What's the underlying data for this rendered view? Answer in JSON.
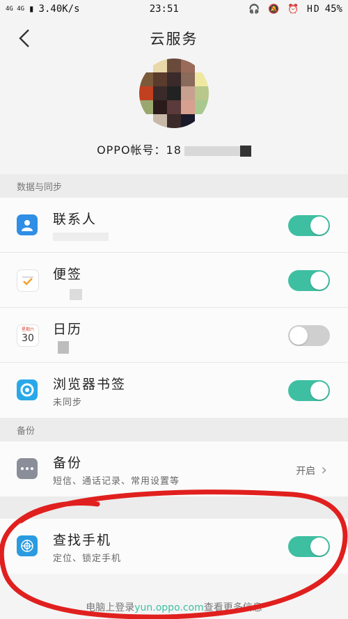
{
  "status_bar": {
    "network": "4G 4G",
    "speed": "3.40K/s",
    "time": "23:51",
    "icons": "🎧 🔕 ⏰ HD",
    "battery": "45%"
  },
  "header": {
    "title": "云服务"
  },
  "profile": {
    "account_label": "OPPO帐号：18"
  },
  "sections": {
    "sync_title": "数据与同步",
    "backup_title": "备份"
  },
  "sync_items": [
    {
      "label": "联系人",
      "sub": ""
    },
    {
      "label": "便签",
      "sub": ""
    },
    {
      "label": "日历",
      "sub": ""
    },
    {
      "label": "浏览器书签",
      "sub": "未同步"
    }
  ],
  "sync_toggles": [
    "on",
    "on",
    "off",
    "on"
  ],
  "calendar_icon": {
    "weekday": "星期六",
    "day": "30"
  },
  "backup_item": {
    "label": "备份",
    "sub": "短信、通话记录、常用设置等",
    "value": "开启"
  },
  "find_item": {
    "label": "查找手机",
    "sub": "定位、锁定手机",
    "toggle": "on"
  },
  "footer": {
    "prefix": "电脑上登录",
    "link": "yun.oppo.com",
    "suffix": "查看更多信息"
  },
  "colors": {
    "accent": "#3fbfa2",
    "annotation": "#e0201e"
  }
}
